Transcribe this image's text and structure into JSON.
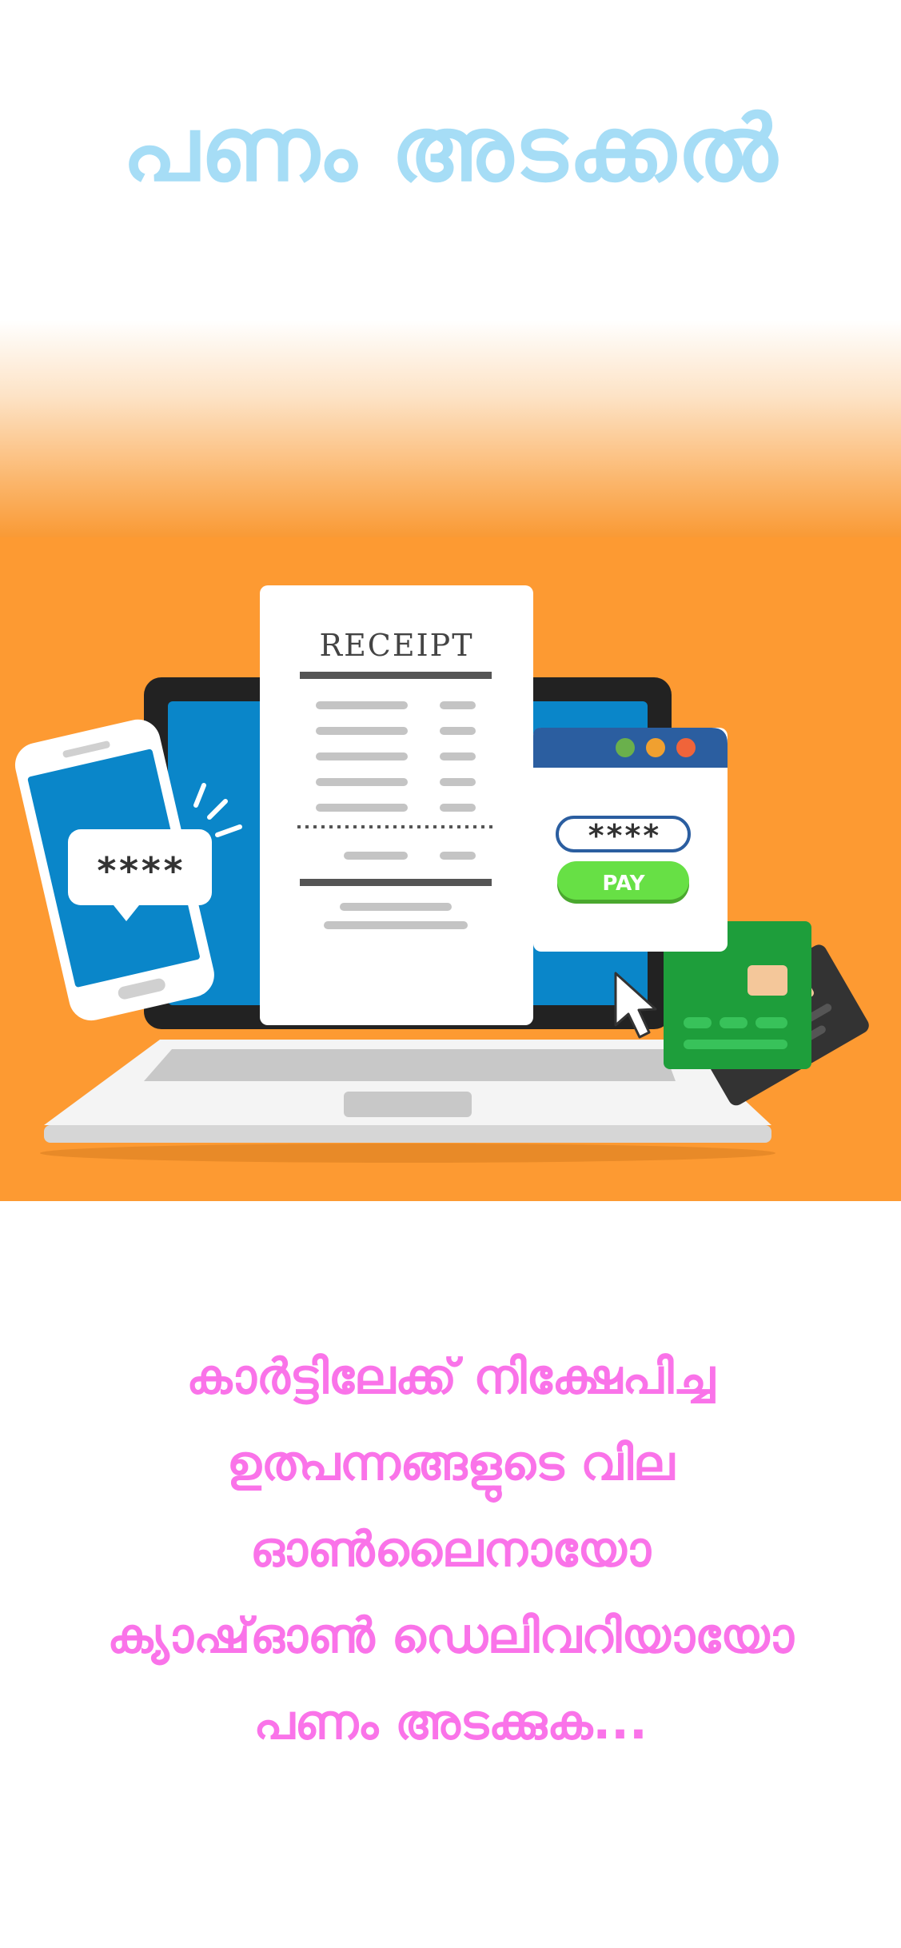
{
  "title": "പണം അടക്കൽ",
  "illustration": {
    "receipt_heading": "RECEIPT",
    "phone_pin": "****",
    "browser_pin": "****",
    "pay_button": "PAY",
    "colors": {
      "background": "#fd9a32",
      "laptop_screen": "#0a86c9",
      "pay_green": "#67e045",
      "card_green": "#1e9e3b",
      "card_dark": "#333333"
    }
  },
  "description": {
    "lines": [
      "കാർട്ടിലേക്ക് നിക്ഷേപിച്ച",
      "ഉത്പന്നങ്ങളുടെ വില",
      "ഓൺലൈനായോ",
      "ക്യാഷ്ഓൺ ഡെലിവറിയായോ",
      "പണം അടക്കുക..."
    ]
  }
}
